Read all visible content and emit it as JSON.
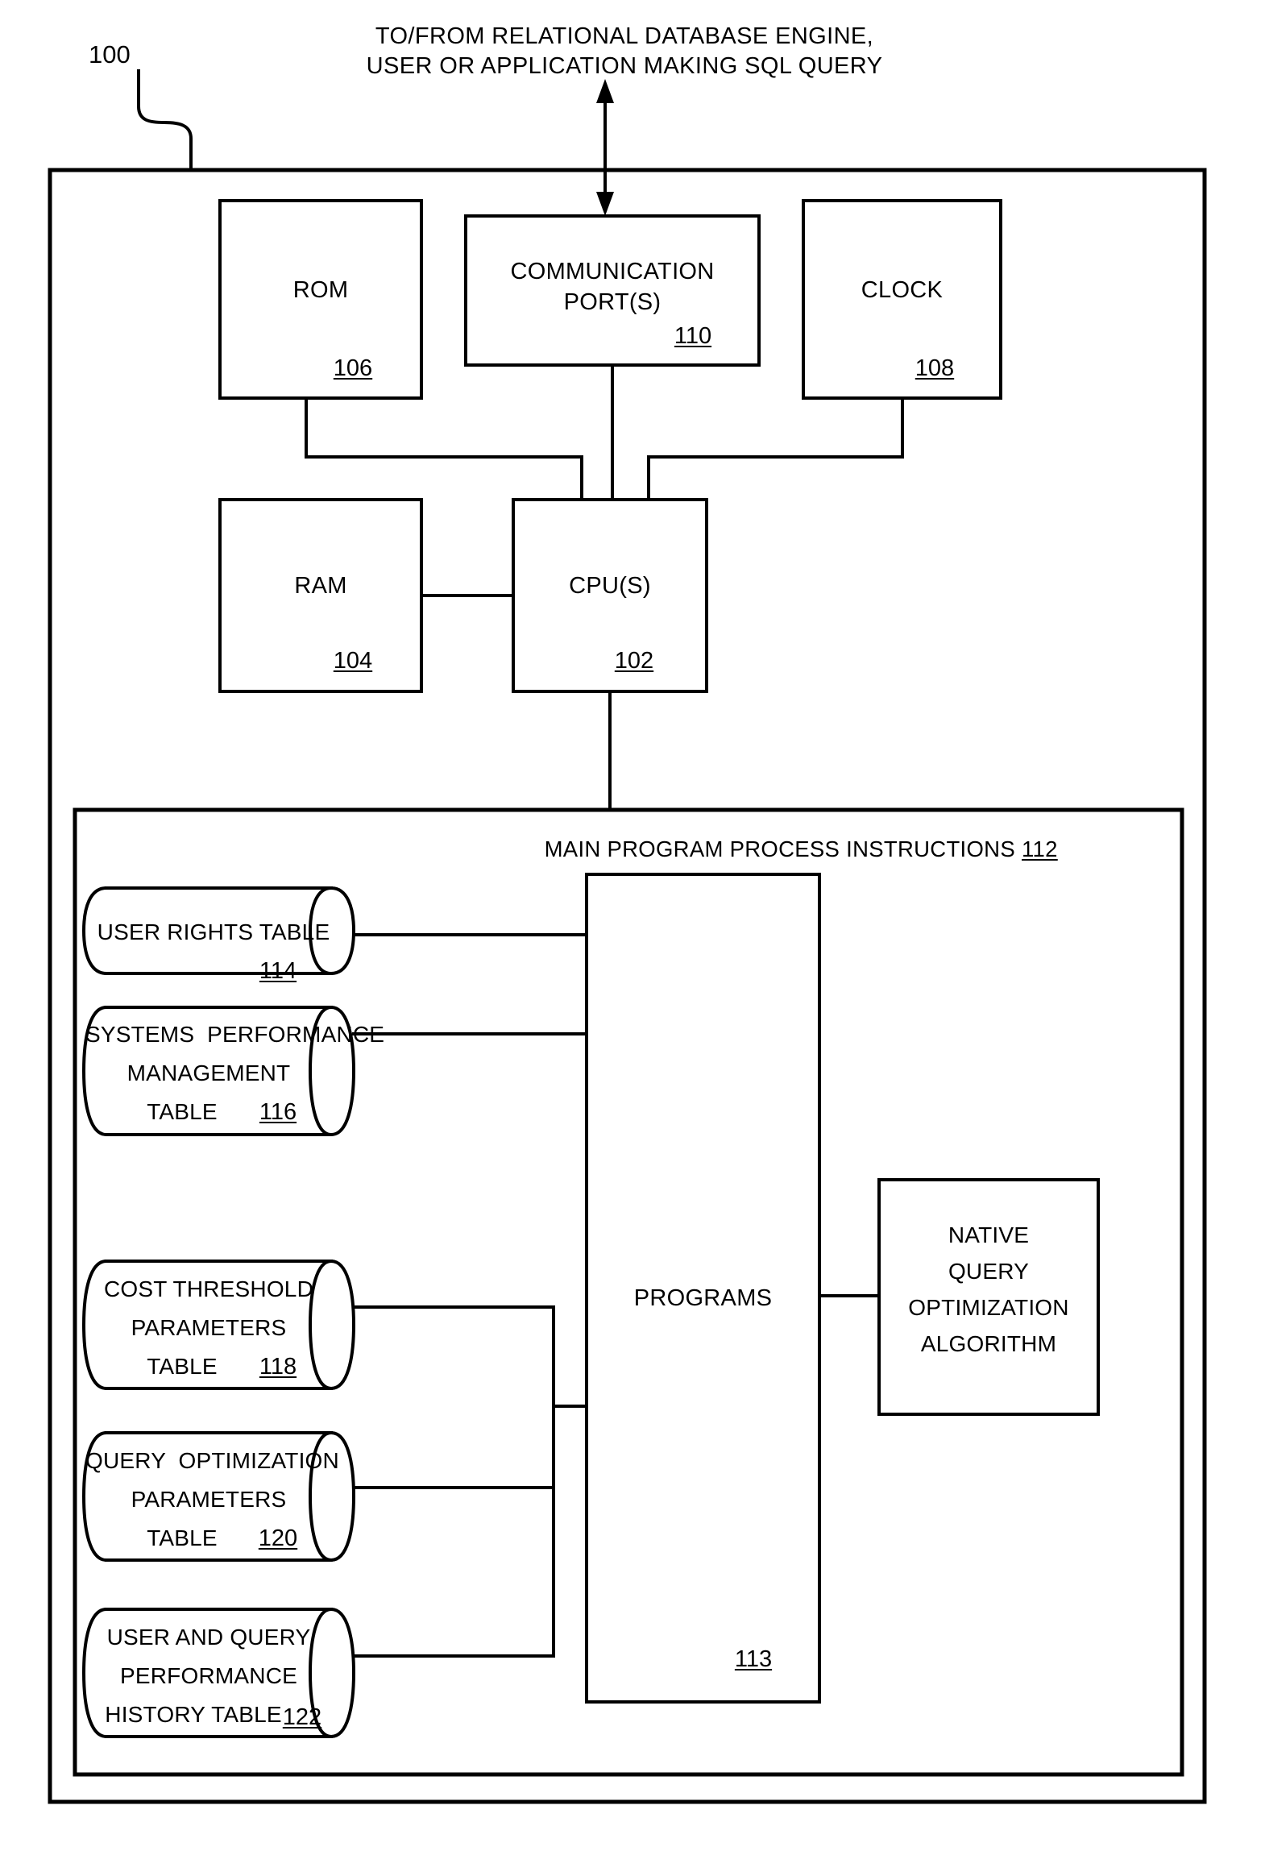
{
  "figure": {
    "top_caption_line1": "TO/FROM RELATIONAL DATABASE ENGINE,",
    "top_caption_line2": "USER OR APPLICATION MAKING SQL QUERY",
    "system_ref": "100"
  },
  "hardware_blocks": [
    {
      "name": "rom",
      "label": "ROM",
      "ref": "106"
    },
    {
      "name": "communication-port",
      "label_line1": "COMMUNICATION",
      "label_line2": "PORT(S)",
      "ref": "110"
    },
    {
      "name": "clock",
      "label": "CLOCK",
      "ref": "108"
    },
    {
      "name": "ram",
      "label": "RAM",
      "ref": "104"
    },
    {
      "name": "cpu",
      "label": "CPU(S)",
      "ref": "102"
    }
  ],
  "main_program": {
    "header_text": "MAIN PROGRAM PROCESS INSTRUCTIONS",
    "header_ref": "112",
    "programs_label": "PROGRAMS",
    "programs_ref": "113",
    "native_algorithm": {
      "line1": "NATIVE",
      "line2": "QUERY",
      "line3": "OPTIMIZATION",
      "line4": "ALGORITHM"
    },
    "tables": [
      {
        "name": "user-rights-table",
        "lines": [
          "USER RIGHTS TABLE"
        ],
        "ref": "114"
      },
      {
        "name": "systems-performance-management-table",
        "lines": [
          "SYSTEMS  PERFORMANCE",
          "MANAGEMENT",
          "TABLE"
        ],
        "ref": "116"
      },
      {
        "name": "cost-threshold-parameters-table",
        "lines": [
          "COST THRESHOLD",
          "PARAMETERS",
          "TABLE"
        ],
        "ref": "118"
      },
      {
        "name": "query-optimization-parameters-table",
        "lines": [
          "QUERY  OPTIMIZATION",
          "PARAMETERS",
          "TABLE"
        ],
        "ref": "120"
      },
      {
        "name": "user-and-query-performance-history-table",
        "lines": [
          "USER AND QUERY",
          "PERFORMANCE",
          "HISTORY TABLE"
        ],
        "ref": "122"
      }
    ]
  },
  "colors": {
    "ink": "#000000",
    "paper": "#ffffff"
  }
}
